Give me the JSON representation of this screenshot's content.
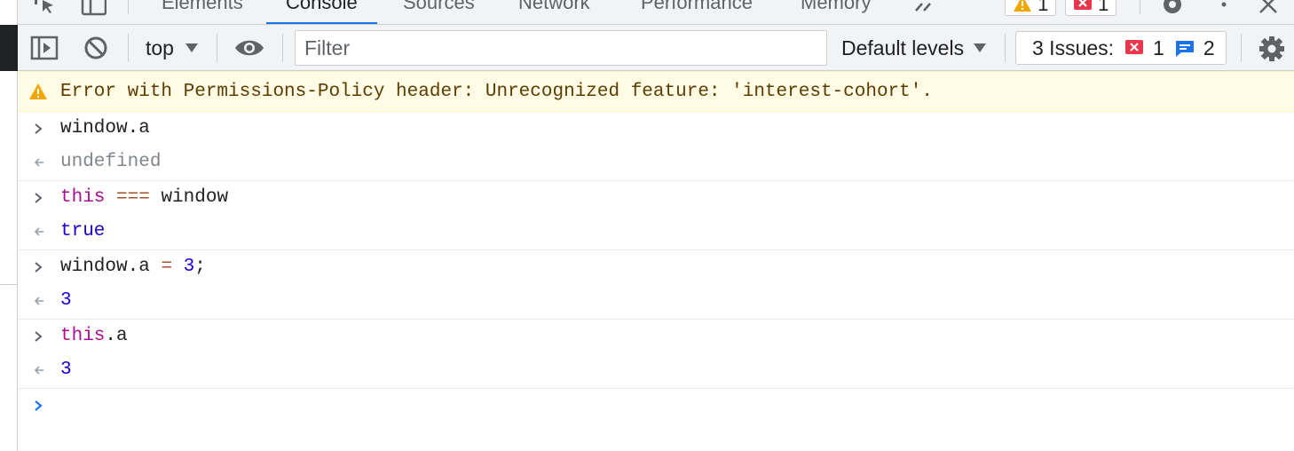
{
  "tabs": [
    {
      "label": "Elements",
      "active": false
    },
    {
      "label": "Console",
      "active": true
    },
    {
      "label": "Sources",
      "active": false
    },
    {
      "label": "Network",
      "active": false
    },
    {
      "label": "Performance",
      "active": false
    },
    {
      "label": "Memory",
      "active": false
    }
  ],
  "tab_badges": {
    "warnings": "1",
    "errors": "1"
  },
  "toolbar": {
    "context": "top",
    "filter_placeholder": "Filter",
    "levels": "Default levels",
    "issues_label": "3 Issues:",
    "issues_errors": "1",
    "issues_info": "2"
  },
  "colors": {
    "accent": "#1a73e8",
    "warning_bg": "#fffbe5",
    "warning_text": "#5c3c00",
    "error": "#e8374a",
    "keyword": "#aa0d91",
    "number": "#1c00cf"
  },
  "console": {
    "warning": "Error with Permissions-Policy header: Unrecognized feature: 'interest-cohort'.",
    "entries": [
      {
        "input": {
          "text": "window.a"
        },
        "output": "undefined"
      },
      {
        "input": {
          "kw": "this",
          "op": "===",
          "rest": "window"
        },
        "output": "true"
      },
      {
        "input": {
          "lhs": "window.a",
          "op": "=",
          "num": "3",
          "end": ";"
        },
        "output": "3"
      },
      {
        "input": {
          "kw": "this",
          "rest": ".a"
        },
        "output": "3"
      }
    ]
  }
}
